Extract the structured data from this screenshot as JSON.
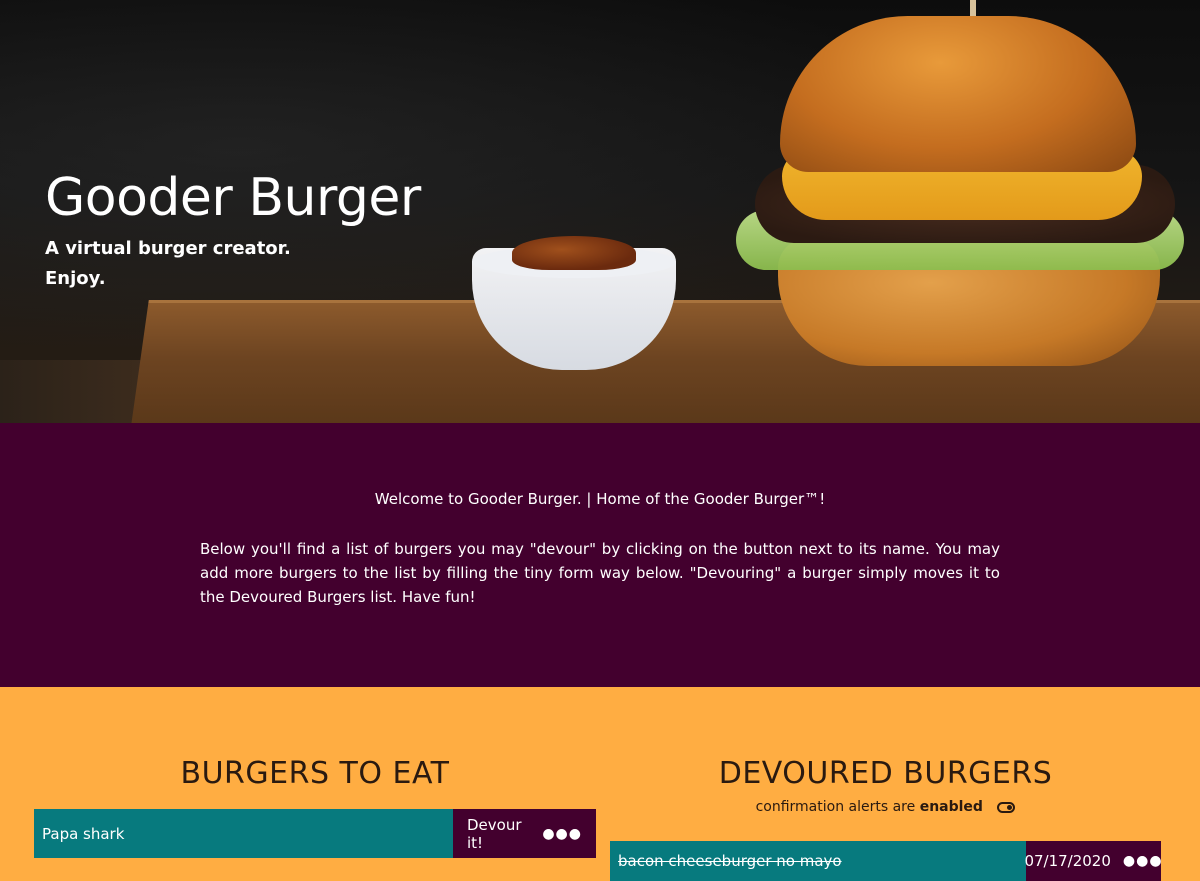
{
  "hero": {
    "title": "Gooder Burger",
    "subtitle_line1": "A virtual burger creator.",
    "subtitle_line2": "Enjoy."
  },
  "intro": {
    "welcome": "Welcome to Gooder Burger. | Home of the Gooder Burger™!",
    "body": "Below you'll find a list of burgers you may \"devour\" by clicking on the button next to its name. You may add more burgers to the list by filling the tiny form way below. \"Devouring\" a burger simply moves it to the Devoured Burgers list. Have fun!"
  },
  "to_eat": {
    "title": "BURGERS TO EAT",
    "items": [
      {
        "name": "Papa shark",
        "button_label": "Devour it!",
        "menu_icon": "ellipsis-icon"
      }
    ]
  },
  "devoured": {
    "title": "DEVOURED BURGERS",
    "confirm_prefix": "confirmation alerts are",
    "confirm_state": "enabled",
    "items": [
      {
        "name": "bacon cheeseburger no mayo",
        "date": "07/17/2020",
        "menu_icon": "ellipsis-icon"
      }
    ]
  },
  "colors": {
    "hero_bg": "#0d0d0d",
    "intro_bg": "#43002e",
    "lists_bg": "#ffad42",
    "row_name_bg": "#077a7e",
    "row_action_bg": "#43002e"
  }
}
